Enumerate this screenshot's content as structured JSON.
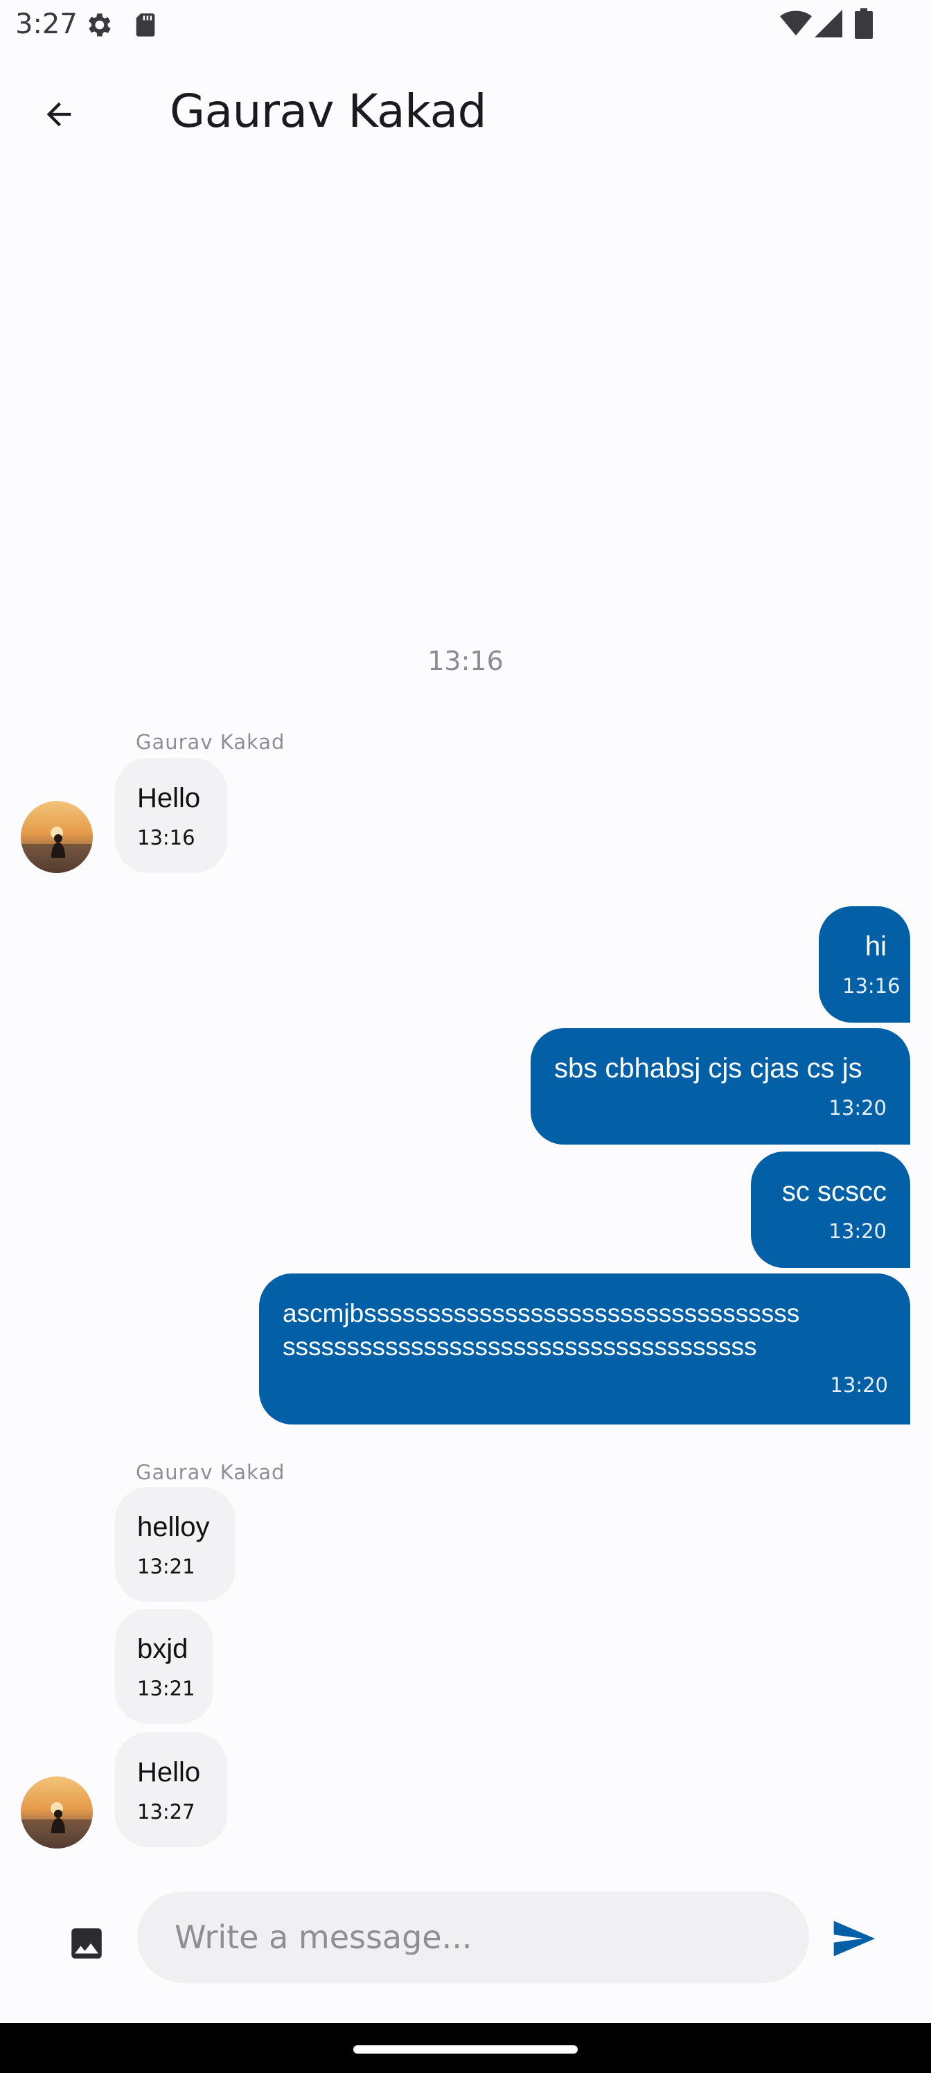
{
  "status_bar": {
    "time": "3:27"
  },
  "header": {
    "title": "Gaurav Kakad"
  },
  "date_separator": "13:16",
  "messages": [
    {
      "sender": "Gaurav Kakad",
      "text": "Hello",
      "time": "13:16"
    },
    {
      "text": "hi",
      "time": "13:16"
    },
    {
      "text": "sbs cbhabsj cjs cjas cs js",
      "time": "13:20"
    },
    {
      "text": "sc scscc",
      "time": "13:20"
    },
    {
      "text": "ascmjbssssssssssssssssssssssssssssssssss\nsssssssssssssssssssssssssssssssssssss",
      "time": "13:20"
    },
    {
      "sender": "Gaurav Kakad",
      "text": "helloy",
      "time": "13:21"
    },
    {
      "text": "bxjd",
      "time": "13:21"
    },
    {
      "text": "Hello",
      "time": "13:27"
    }
  ],
  "composer": {
    "placeholder": "Write a message..."
  },
  "colors": {
    "outgoing": "#0360a6",
    "incoming": "#f2f1f4",
    "background": "#fcfbfe"
  }
}
